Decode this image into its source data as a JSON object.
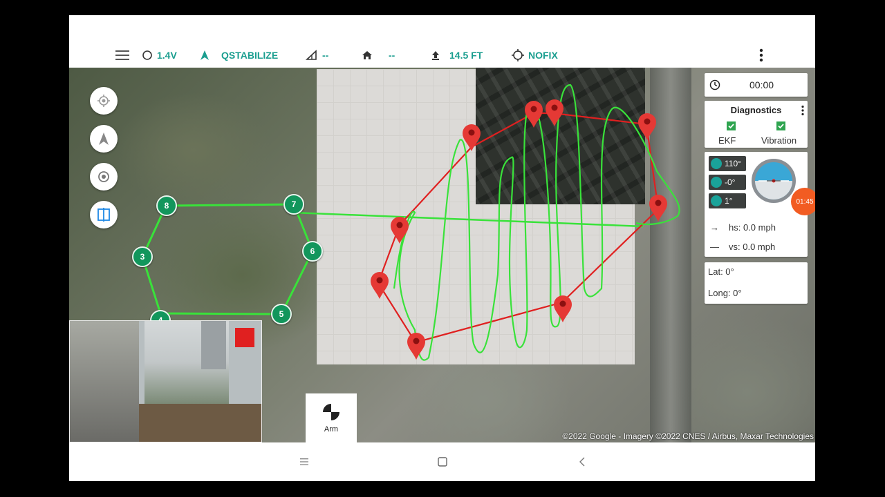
{
  "topbar": {
    "battery": "1.4V",
    "mode": "QSTABILIZE",
    "signal": "--",
    "home": "--",
    "altitude": "14.5 FT",
    "gps": "NOFIX"
  },
  "map": {
    "waypoints": [
      "8",
      "7",
      "6",
      "5",
      "4",
      "3"
    ],
    "attribution": "©2022 Google - Imagery ©2022 CNES / Airbus, Maxar Technologies"
  },
  "arm": {
    "label": "Arm"
  },
  "timer": {
    "value": "00:00"
  },
  "diagnostics": {
    "title": "Diagnostics",
    "ekf": "EKF",
    "vibration": "Vibration"
  },
  "attitude": {
    "yaw": "110°",
    "pitch": "-0°",
    "roll": "1°"
  },
  "speed": {
    "hs": "hs: 0.0 mph",
    "vs": "vs: 0.0 mph"
  },
  "position": {
    "lat": "Lat: 0°",
    "long": "Long: 0°"
  },
  "flight_time_bubble": "01:45",
  "colors": {
    "accent": "#1a9e8f",
    "waypoint": "#12965c",
    "path_green": "#39e23a",
    "path_red": "#e02020",
    "pin": "#e53935"
  }
}
